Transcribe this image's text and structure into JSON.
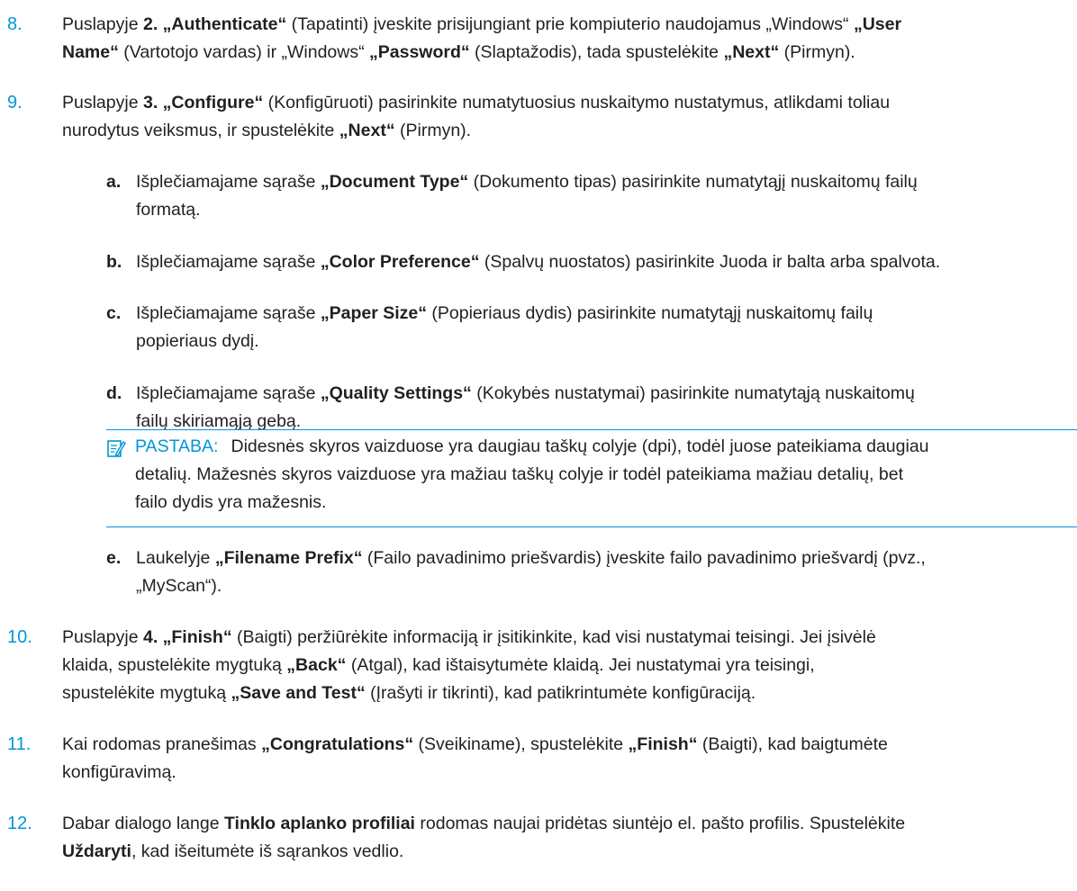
{
  "steps": [
    {
      "number": "8.",
      "line1_a": "Puslapyje ",
      "line1_b": "2. „Authenticate“",
      "line1_c": " (Tapatinti) įveskite prisijungiant prie kompiuterio naudojamus „Windows“ ",
      "line1_d": "„User",
      "line2_a": "Name“",
      "line2_b": " (Vartotojo vardas) ir „Windows“ ",
      "line2_c": "„Password“",
      "line2_d": " (Slaptažodis), tada spustelėkite ",
      "line2_e": "„Next“",
      "line2_f": " (Pirmyn)."
    },
    {
      "number": "9.",
      "line1_a": "Puslapyje ",
      "line1_b": "3. „Configure“",
      "line1_c": " (Konfigūruoti) pasirinkite numatytuosius nuskaitymo nustatymus, atlikdami toliau",
      "line2_a": "nurodytus veiksmus, ir spustelėkite ",
      "line2_b": "„Next“",
      "line2_c": " (Pirmyn)."
    },
    {
      "number": "10.",
      "line1_a": "Puslapyje ",
      "line1_b": "4. „Finish“",
      "line1_c": " (Baigti) peržiūrėkite informaciją ir įsitikinkite, kad visi nustatymai teisingi. Jei įsivėlė",
      "line2_a": "klaida, spustelėkite mygtuką ",
      "line2_b": "„Back“",
      "line2_c": " (Atgal), kad ištaisytumėte klaidą. Jei nustatymai yra teisingi,",
      "line3_a": "spustelėkite mygtuką ",
      "line3_b": "„Save and Test“",
      "line3_c": " (Įrašyti ir tikrinti), kad patikrintumėte konfigūraciją."
    },
    {
      "number": "11.",
      "line1_a": "Kai rodomas pranešimas ",
      "line1_b": "„Congratulations“",
      "line1_c": " (Sveikiname), spustelėkite ",
      "line1_d": "„Finish“",
      "line1_e": " (Baigti), kad baigtumėte",
      "line2_a": "konfigūravimą."
    },
    {
      "number": "12.",
      "line1_a": "Dabar dialogo lange ",
      "line1_b": "Tinklo aplanko profiliai",
      "line1_c": " rodomas naujai pridėtas siuntėjo el. pašto profilis. Spustelėkite",
      "line2_a": "Uždaryti",
      "line2_b": ", kad išeitumėte iš sąrankos vedlio."
    }
  ],
  "substeps": [
    {
      "letter": "a.",
      "line1_a": "Išplečiamajame sąraše ",
      "line1_b": "„Document Type“",
      "line1_c": " (Dokumento tipas) pasirinkite numatytąjį nuskaitomų failų",
      "line2_a": "formatą."
    },
    {
      "letter": "b.",
      "line1_a": "Išplečiamajame sąraše ",
      "line1_b": "„Color Preference“",
      "line1_c": " (Spalvų nuostatos) pasirinkite Juoda ir balta arba spalvota."
    },
    {
      "letter": "c.",
      "line1_a": "Išplečiamajame sąraše ",
      "line1_b": "„Paper Size“",
      "line1_c": " (Popieriaus dydis) pasirinkite numatytąjį nuskaitomų failų",
      "line2_a": "popieriaus dydį."
    },
    {
      "letter": "d.",
      "line1_a": "Išplečiamajame sąraše ",
      "line1_b": "„Quality Settings“",
      "line1_c": " (Kokybės nustatymai) pasirinkite numatytąją nuskaitomų",
      "line2_a": "failų skiriamąją gebą."
    },
    {
      "letter": "e.",
      "line1_a": "Laukelyje ",
      "line1_b": "„Filename Prefix“",
      "line1_c": " (Failo pavadinimo priešvardis) įveskite failo pavadinimo priešvardį (pvz.,",
      "line2_a": "„MyScan“)."
    }
  ],
  "note": {
    "label": "PASTABA:",
    "line1": "Didesnės skyros vaizduose yra daugiau taškų colyje (dpi), todėl juose pateikiama daugiau",
    "line2": "detalių. Mažesnės skyros vaizduose yra mažiau taškų colyje ir todėl pateikiama mažiau detalių, bet",
    "line3": "failo dydis yra mažesnis.",
    "icon": "note-icon"
  },
  "colors": {
    "accent": "#0096d6",
    "text": "#231f20"
  }
}
